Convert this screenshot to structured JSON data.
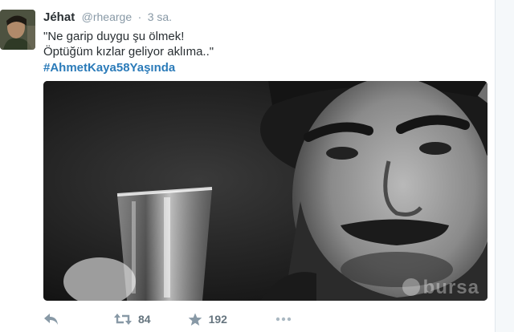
{
  "tweet": {
    "author": {
      "display_name": "Jéhat",
      "username": "@rhearge"
    },
    "separator": "·",
    "timestamp": "3 sa.",
    "text_lines": [
      "\"Ne garip duygu şu ölmek!",
      "Öptüğüm kızlar geliyor aklıma..\""
    ],
    "hashtag": "#AhmetKaya58Yaşında",
    "media": {
      "watermark_text": "bursa"
    },
    "actions": {
      "reply_icon": "reply-icon",
      "retweet_icon": "retweet-icon",
      "retweet_count": "84",
      "favorite_icon": "star-icon",
      "favorite_count": "192"
    }
  },
  "colors": {
    "link": "#2b7bb9",
    "muted": "#8899a6",
    "text": "#292f33"
  }
}
